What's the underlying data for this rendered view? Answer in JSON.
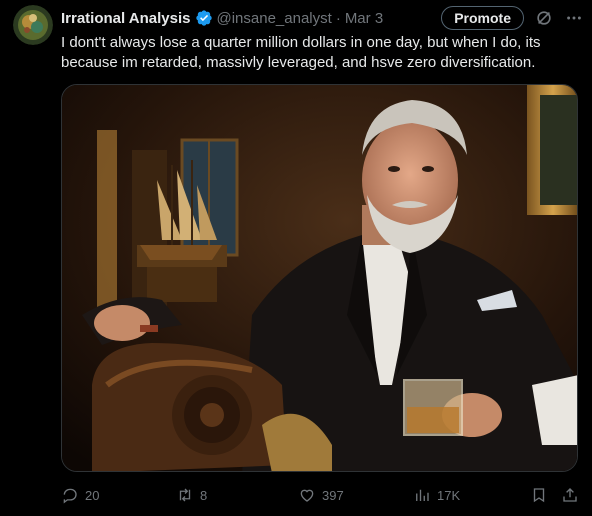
{
  "tweet": {
    "author": {
      "display_name": "Irrational Analysis",
      "handle": "@insane_analyst",
      "verified_icon": "verified-badge-icon"
    },
    "separator": "·",
    "date": "Mar 3",
    "promote_label": "Promote",
    "text": "I dont't always lose a quarter million dollars in one day, but when I do, its because im retarded, massivly leveraged, and hsve zero diversification."
  },
  "actions": {
    "replies": "20",
    "reposts": "8",
    "likes": "397",
    "views": "17K"
  },
  "colors": {
    "background": "#000000",
    "text": "#e7e9ea",
    "muted": "#71767b",
    "verified": "#1d9bf0",
    "border": "#2f3336"
  }
}
